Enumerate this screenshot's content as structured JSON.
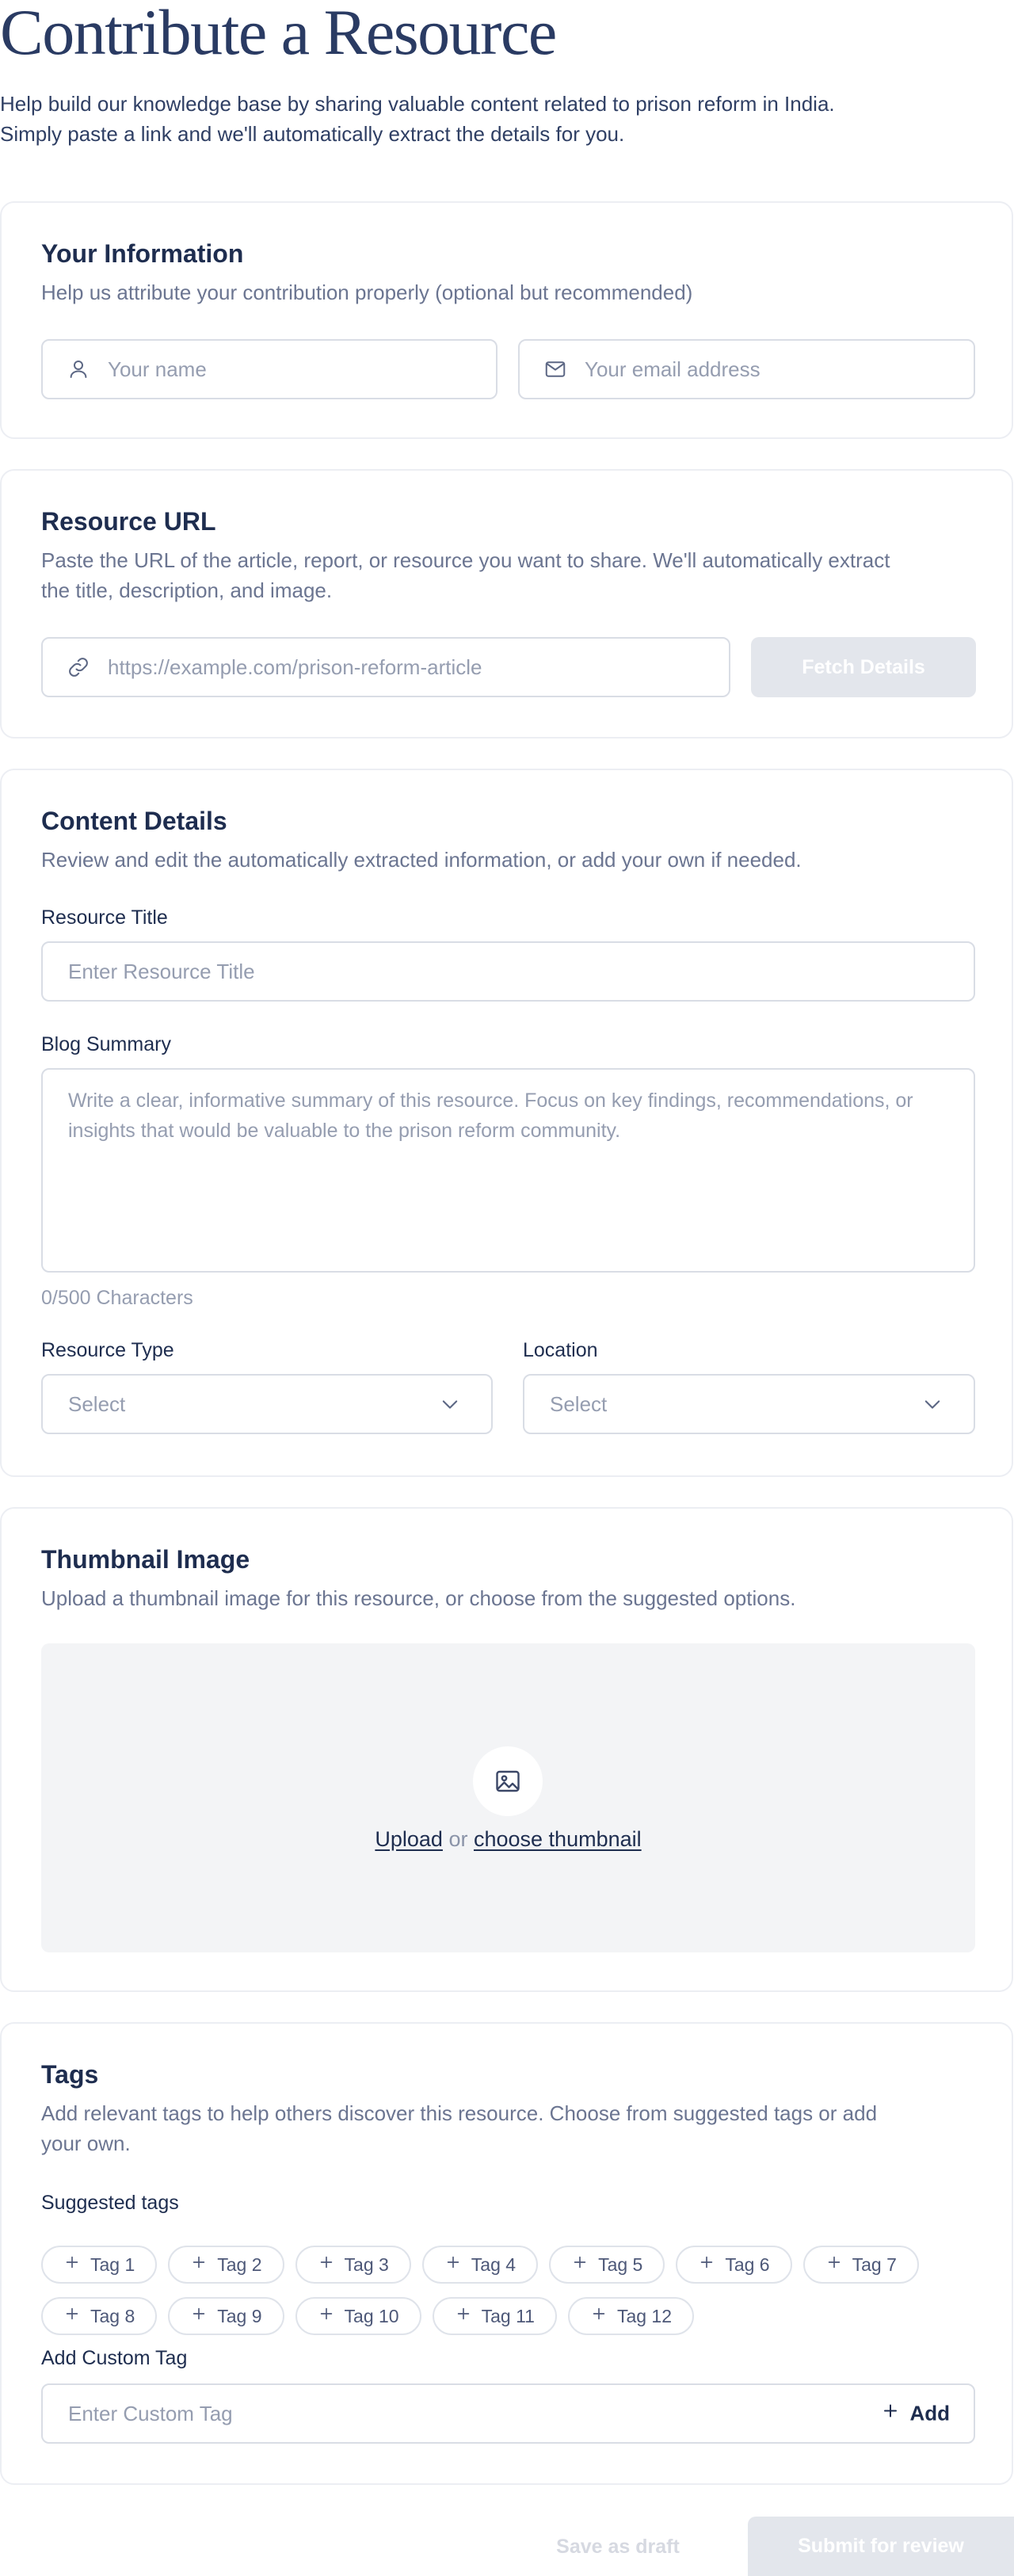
{
  "header": {
    "title": "Contribute a Resource",
    "intro": "Help build our knowledge base by sharing valuable content related to prison reform in India. Simply paste a link and we'll automatically extract the details for you."
  },
  "your_info": {
    "title": "Your Information",
    "description": "Help us attribute your contribution properly (optional but recommended)",
    "name_placeholder": "Your name",
    "email_placeholder": "Your email address"
  },
  "resource_url": {
    "title": "Resource URL",
    "description": "Paste the URL of the article, report, or resource you want to share. We'll automatically extract the title, description, and image.",
    "url_placeholder": "https://example.com/prison-reform-article",
    "fetch_label": "Fetch Details"
  },
  "content_details": {
    "title": "Content Details",
    "description": "Review and edit the automatically extracted information, or add your own if needed.",
    "title_label": "Resource Title",
    "title_placeholder": "Enter Resource Title",
    "summary_label": "Blog Summary",
    "summary_placeholder": "Write a clear, informative summary of this resource. Focus on key findings, recommendations, or insights that would be valuable to the prison reform community.",
    "char_count": "0/500 Characters",
    "type_label": "Resource Type",
    "type_value": "Select",
    "location_label": "Location",
    "location_value": "Select"
  },
  "thumbnail": {
    "title": "Thumbnail Image",
    "description": "Upload a thumbnail image for this resource, or choose from the suggested options.",
    "upload_label": "Upload",
    "or_label": "or",
    "choose_label": "choose thumbnail"
  },
  "tags": {
    "title": "Tags",
    "description": "Add relevant tags to help others discover this resource. Choose from suggested tags or add your own.",
    "suggested_label": "Suggested tags",
    "row1": [
      "Tag 1",
      "Tag 2",
      "Tag 3",
      "Tag 4",
      "Tag 5",
      "Tag 6",
      "Tag 7"
    ],
    "row2": [
      "Tag 8",
      "Tag 9",
      "Tag 10",
      "Tag 11",
      "Tag 12"
    ],
    "custom_label": "Add Custom Tag",
    "custom_placeholder": "Enter Custom Tag",
    "add_label": "Add"
  },
  "footer": {
    "draft_label": "Save as draft",
    "submit_label": "Submit for review"
  }
}
